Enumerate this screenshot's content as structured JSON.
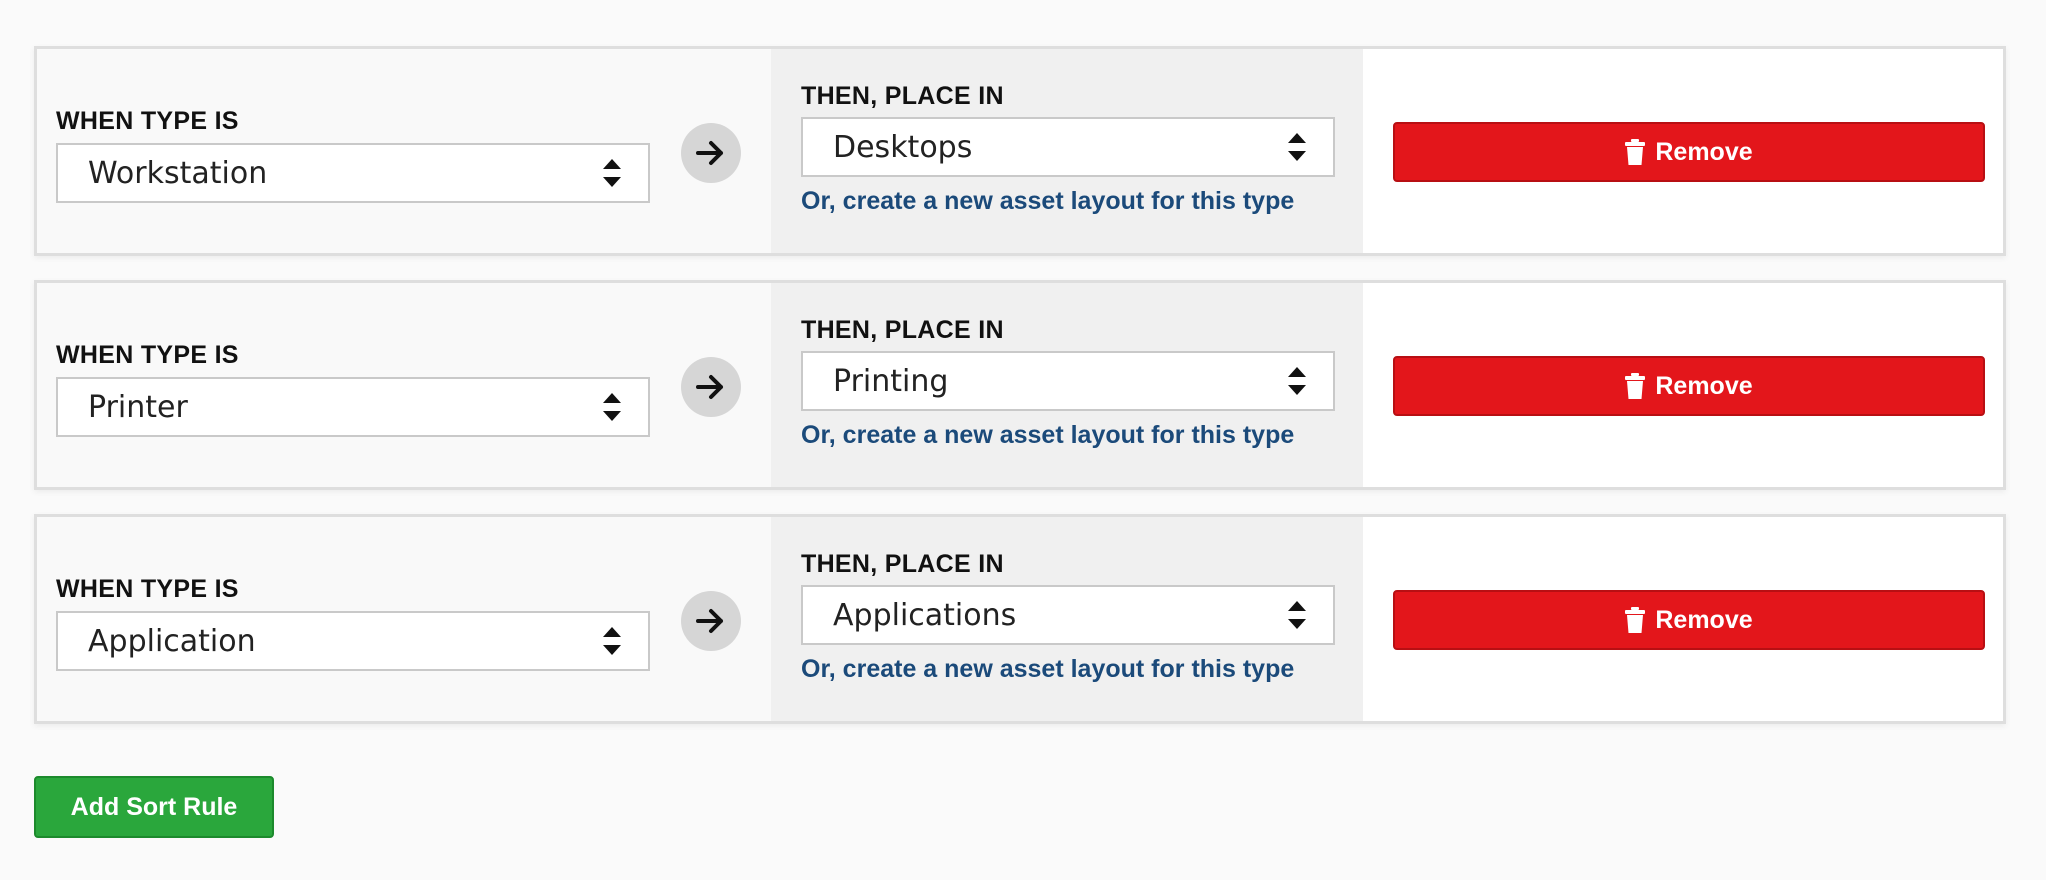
{
  "rules": [
    {
      "when_label": "WHEN TYPE IS",
      "type_value": "Workstation",
      "then_label": "THEN, PLACE IN",
      "place_value": "Desktops",
      "create_link": "Or, create a new asset layout for this type",
      "remove_label": "Remove"
    },
    {
      "when_label": "WHEN TYPE IS",
      "type_value": "Printer",
      "then_label": "THEN, PLACE IN",
      "place_value": "Printing",
      "create_link": "Or, create a new asset layout for this type",
      "remove_label": "Remove"
    },
    {
      "when_label": "WHEN TYPE IS",
      "type_value": "Application",
      "then_label": "THEN, PLACE IN",
      "place_value": "Applications",
      "create_link": "Or, create a new asset layout for this type",
      "remove_label": "Remove"
    }
  ],
  "add_rule_label": "Add Sort Rule",
  "colors": {
    "remove": "#e3161b",
    "add": "#2aa73c",
    "link": "#1b4a7a"
  },
  "icons": {
    "arrow": "arrow-right-icon",
    "trash": "trash-icon",
    "select": "select-updown-icon"
  }
}
